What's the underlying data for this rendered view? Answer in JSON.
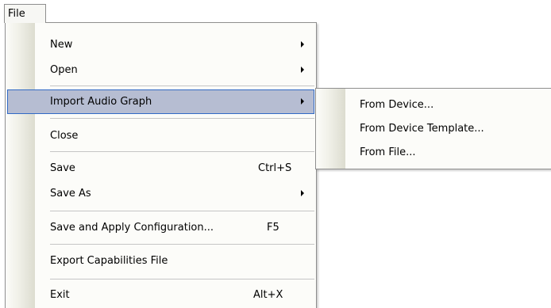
{
  "menubar": {
    "file_label": "File"
  },
  "file_menu": {
    "new_label": "New",
    "open_label": "Open",
    "import_audio_graph_label": "Import Audio Graph",
    "close_label": "Close",
    "save_label": "Save",
    "save_shortcut": "Ctrl+S",
    "save_as_label": "Save As",
    "save_apply_label": "Save and Apply Configuration...",
    "save_apply_shortcut": "F5",
    "export_capabilities_label": "Export Capabilities File",
    "exit_label": "Exit",
    "exit_shortcut": "Alt+X",
    "highlighted_item": "Import Audio Graph"
  },
  "import_submenu": {
    "items": [
      {
        "label": "From Device..."
      },
      {
        "label": "From Device Template..."
      },
      {
        "label": "From File..."
      }
    ]
  },
  "icons": {
    "submenu_arrow": "chevron-right-icon"
  },
  "colors": {
    "highlight_bg": "#b6bdd2",
    "highlight_border": "#316ac5",
    "menu_border": "#8e8e8e",
    "menu_bg": "#fcfcf9"
  }
}
